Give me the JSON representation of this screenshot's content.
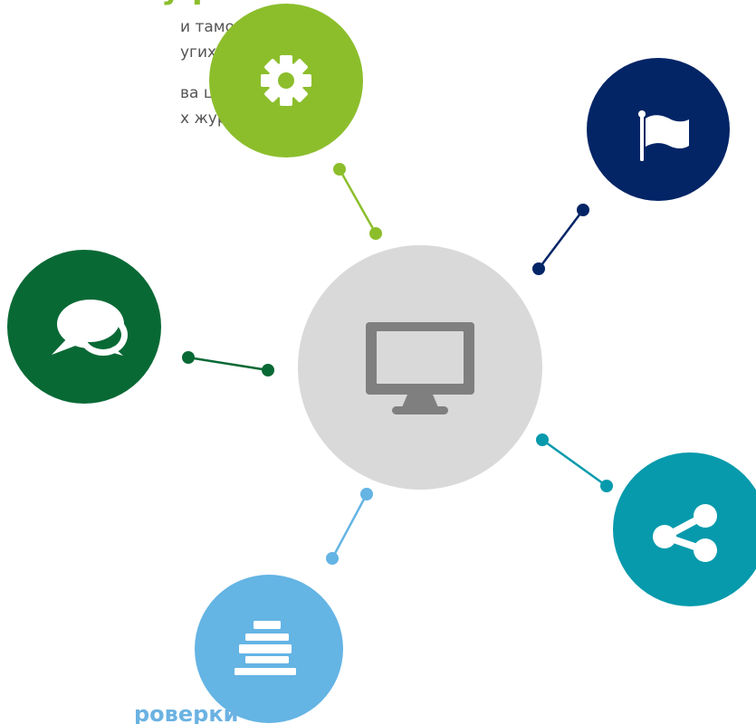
{
  "heading_top_fragment": "у   р",
  "text_lines": [
    "и таможенные",
    "угих стран",
    "ва ценовых и",
    "х журналов"
  ],
  "heading_bottom_fragment": "роверки",
  "colors": {
    "lime_green": "#8cbe2c",
    "navy": "#032566",
    "dark_green": "#096935",
    "teal": "#069aac",
    "light_blue": "#64b4e4",
    "center_gray": "#d9d9d9",
    "icon_gray": "#7f7f7f"
  },
  "icons": {
    "hub": "monitor-icon",
    "lime_green": "gear-icon",
    "navy": "flag-icon",
    "dark_green": "chat-bubbles-icon",
    "teal": "share-icon",
    "light_blue": "stacked-bars-icon"
  }
}
